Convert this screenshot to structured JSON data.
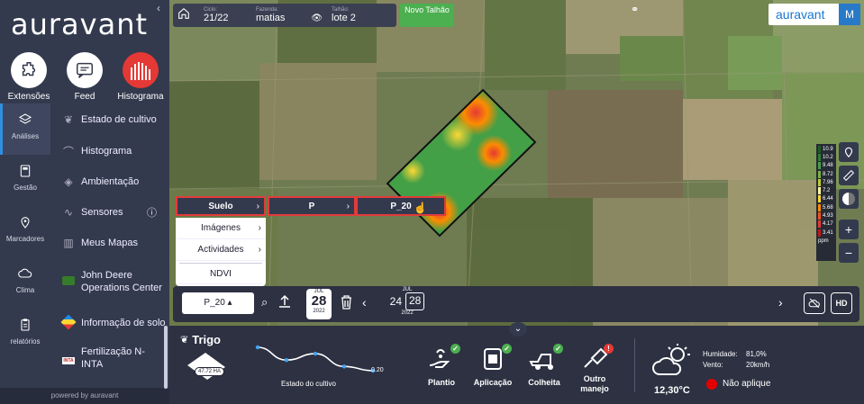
{
  "sidebar": {
    "logo": "auravant",
    "collapse_glyph": "‹",
    "quick": [
      {
        "label": "Extensões",
        "icon": "puzzle-icon"
      },
      {
        "label": "Feed",
        "icon": "chat-icon"
      },
      {
        "label": "Histograma",
        "icon": "histogram-icon"
      }
    ],
    "rail": [
      {
        "label": "Análises",
        "icon": "layers-icon",
        "active": true
      },
      {
        "label": "Gestão",
        "icon": "notebook-icon"
      },
      {
        "label": "Marcadores",
        "icon": "pin-icon"
      },
      {
        "label": "Clima",
        "icon": "cloud-icon"
      },
      {
        "label": "relatórios",
        "icon": "report-icon"
      }
    ],
    "menu": [
      {
        "label": "Estado de cultivo",
        "icon": "seedling-icon"
      },
      {
        "label": "Histograma",
        "icon": "wave-icon"
      },
      {
        "label": "Ambientação",
        "icon": "layers-icon"
      },
      {
        "label": "Sensores",
        "icon": "pulse-icon",
        "info": "ⓘ"
      },
      {
        "label": "Meus Mapas",
        "icon": "map-icon"
      },
      {
        "label": "John Deere Operations Center",
        "icon": "tractor-icon"
      },
      {
        "label": "Informação de solo",
        "icon": "soil-icon"
      },
      {
        "label": "Fertilização N-INTA",
        "icon": "inta-icon",
        "badge": "INTA"
      }
    ],
    "powered_by": "powered by auravant"
  },
  "topbar": {
    "cycle_label": "Ciclo:",
    "cycle_value": "21/22",
    "farm_label": "Fazenda:",
    "farm_value": "matias",
    "field_label": "Talhão:",
    "field_value": "lote 2",
    "new_field_button": "Novo Talhão"
  },
  "brand": {
    "name": "auravant",
    "avatar": "M"
  },
  "legend": [
    {
      "value": "10.9",
      "color": "#1b5e20"
    },
    {
      "value": "10.2",
      "color": "#2e7d32"
    },
    {
      "value": "9.48",
      "color": "#43a047"
    },
    {
      "value": "8.72",
      "color": "#7cb342"
    },
    {
      "value": "7.96",
      "color": "#c0ca33"
    },
    {
      "value": "7.2",
      "color": "#fff59d"
    },
    {
      "value": "6.44",
      "color": "#fdd835"
    },
    {
      "value": "5.68",
      "color": "#fb8c00"
    },
    {
      "value": "4.93",
      "color": "#f4511e"
    },
    {
      "value": "4.17",
      "color": "#e53935"
    },
    {
      "value": "3.41",
      "color": "#b71c1c"
    }
  ],
  "legend_unit": "ppm",
  "map_tools": {
    "zoom_in": "+",
    "zoom_out": "−"
  },
  "dropdowns": {
    "level1": "Suelo",
    "level2": "P",
    "level3": "P_20",
    "chev": "›",
    "submenu": [
      {
        "label": "Imágenes",
        "chev": "›"
      },
      {
        "label": "Actividades",
        "chev": "›"
      },
      {
        "label": "NDVI",
        "chev": ""
      }
    ]
  },
  "controls": {
    "layer_select": "P_20 ▴",
    "date_month": "JUL",
    "date_day": "28",
    "date_year": "2022",
    "compare_month": "JUL",
    "compare_day_a": "24",
    "compare_day_b": "28",
    "compare_year": "2022",
    "hd_label": "HD",
    "prev": "‹",
    "next": "›"
  },
  "crop": {
    "name": "Trigo",
    "area": "47.72 HA",
    "chart_data": {
      "type": "line",
      "values": [
        0.42,
        0.3,
        0.36,
        0.24,
        0.2
      ],
      "end_label": "0.20"
    },
    "chart_label": "Estado do cultivo"
  },
  "activities": [
    {
      "label": "Plantio",
      "status": "done"
    },
    {
      "label": "Aplicação",
      "status": "done"
    },
    {
      "label": "Colheita",
      "status": "done"
    },
    {
      "label": "Outro manejo",
      "status": "warning"
    }
  ],
  "weather": {
    "temperature": "12,30°C",
    "humidity_label": "Humidade:",
    "humidity_value": "81,0%",
    "wind_label": "Vento:",
    "wind_value": "20km/h",
    "advice": "Não aplique"
  },
  "colors": {
    "accent": "#2979c9",
    "green": "#4caf50",
    "red": "#e53935"
  }
}
